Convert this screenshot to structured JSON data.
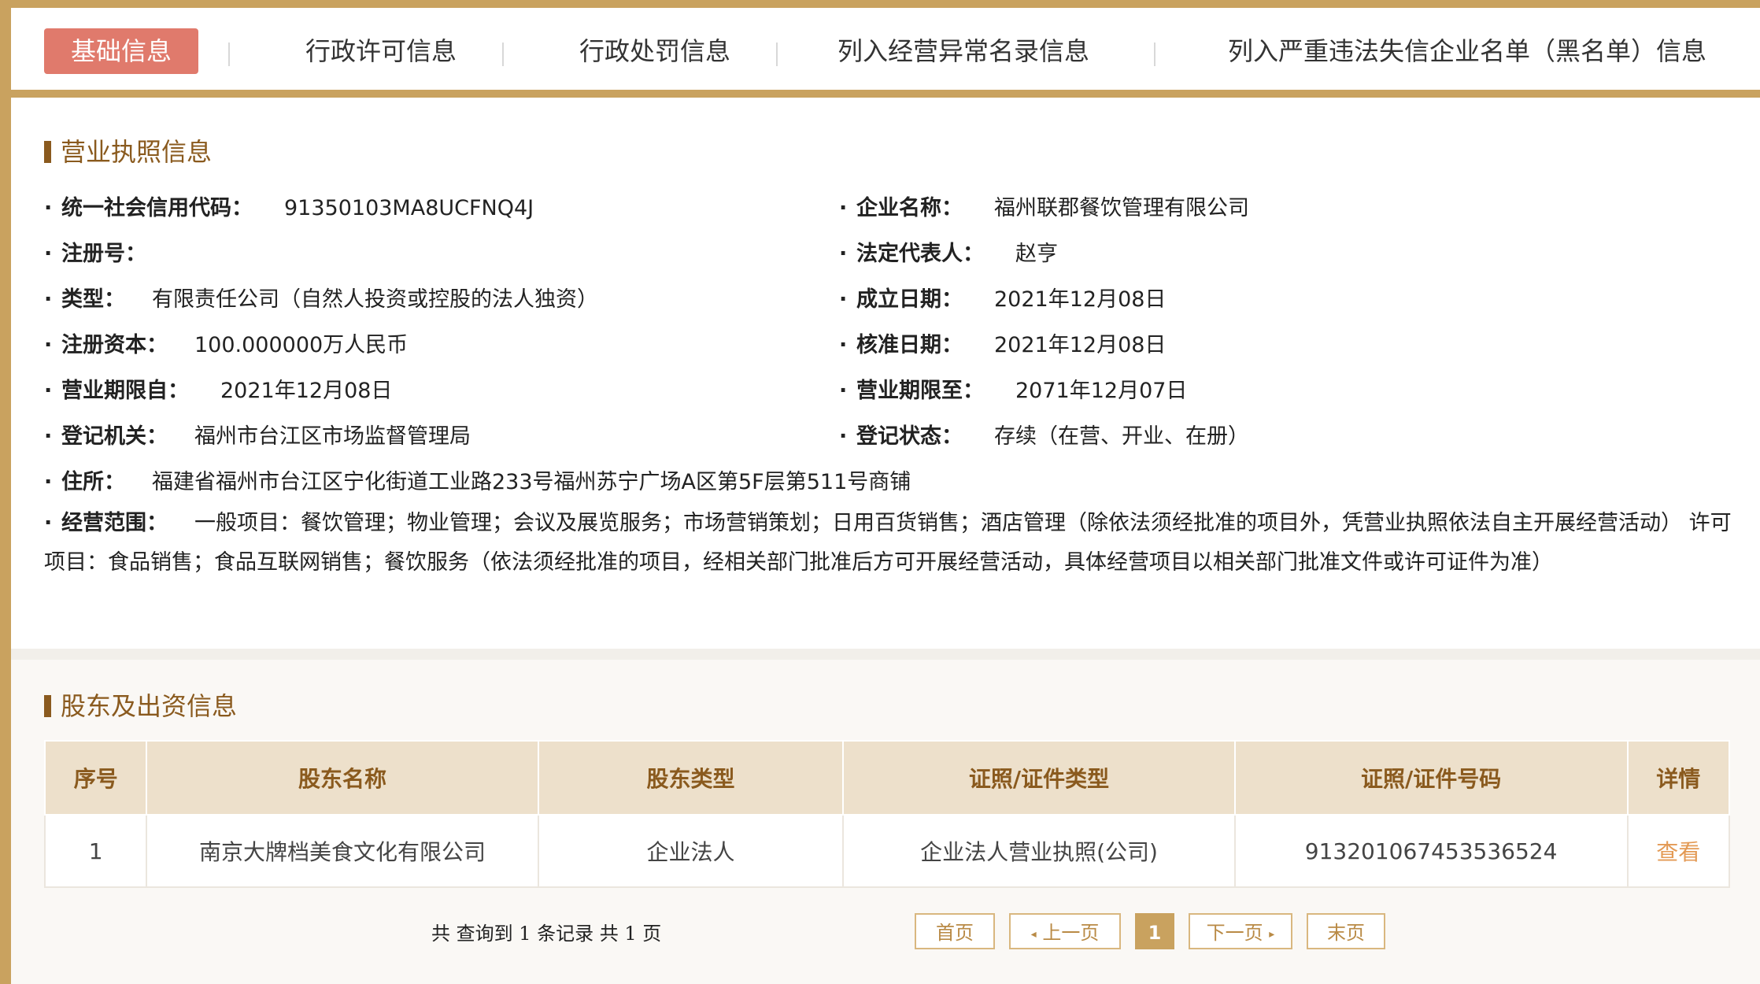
{
  "tabs": {
    "basic": "基础信息",
    "license": "行政许可信息",
    "penalty": "行政处罚信息",
    "abnormal": "列入经营异常名录信息",
    "blacklist": "列入严重违法失信企业名单（黑名单）信息"
  },
  "license_section": {
    "title": "营业执照信息",
    "credit_code_label": "统一社会信用代码：",
    "credit_code": "91350103MA8UCFNQ4J",
    "company_name_label": "企业名称：",
    "company_name": "福州联郡餐饮管理有限公司",
    "reg_no_label": "注册号：",
    "reg_no": "",
    "legal_rep_label": "法定代表人：",
    "legal_rep": "赵亨",
    "type_label": "类型：",
    "type": "有限责任公司（自然人投资或控股的法人独资）",
    "founded_label": "成立日期：",
    "founded": "2021年12月08日",
    "capital_label": "注册资本：",
    "capital": "100.000000万人民币",
    "approved_label": "核准日期：",
    "approved": "2021年12月08日",
    "term_from_label": "营业期限自：",
    "term_from": "2021年12月08日",
    "term_to_label": "营业期限至：",
    "term_to": "2071年12月07日",
    "authority_label": "登记机关：",
    "authority": "福州市台江区市场监督管理局",
    "status_label": "登记状态：",
    "status": "存续（在营、开业、在册）",
    "address_label": "住所：",
    "address": "福建省福州市台江区宁化街道工业路233号福州苏宁广场A区第5F层第511号商铺",
    "scope_label": "经营范围：",
    "scope": "一般项目：餐饮管理；物业管理；会议及展览服务；市场营销策划；日用百货销售；酒店管理（除依法须经批准的项目外，凭营业执照依法自主开展经营活动） 许可项目：食品销售；食品互联网销售；餐饮服务（依法须经批准的项目，经相关部门批准后方可开展经营活动，具体经营项目以相关部门批准文件或许可证件为准）"
  },
  "shareholder_section": {
    "title": "股东及出资信息",
    "columns": [
      "序号",
      "股东名称",
      "股东类型",
      "证照/证件类型",
      "证照/证件号码",
      "详情"
    ],
    "rows": [
      [
        "1",
        "南京大牌档美食文化有限公司",
        "企业法人",
        "企业法人营业执照(公司)",
        "913201067453536524",
        "查看"
      ]
    ]
  },
  "pagination": {
    "summary": "共 查询到 1 条记录 共 1 页",
    "first": "首页",
    "prev": "上一页",
    "current": "1",
    "next": "下一页",
    "last": "末页"
  }
}
